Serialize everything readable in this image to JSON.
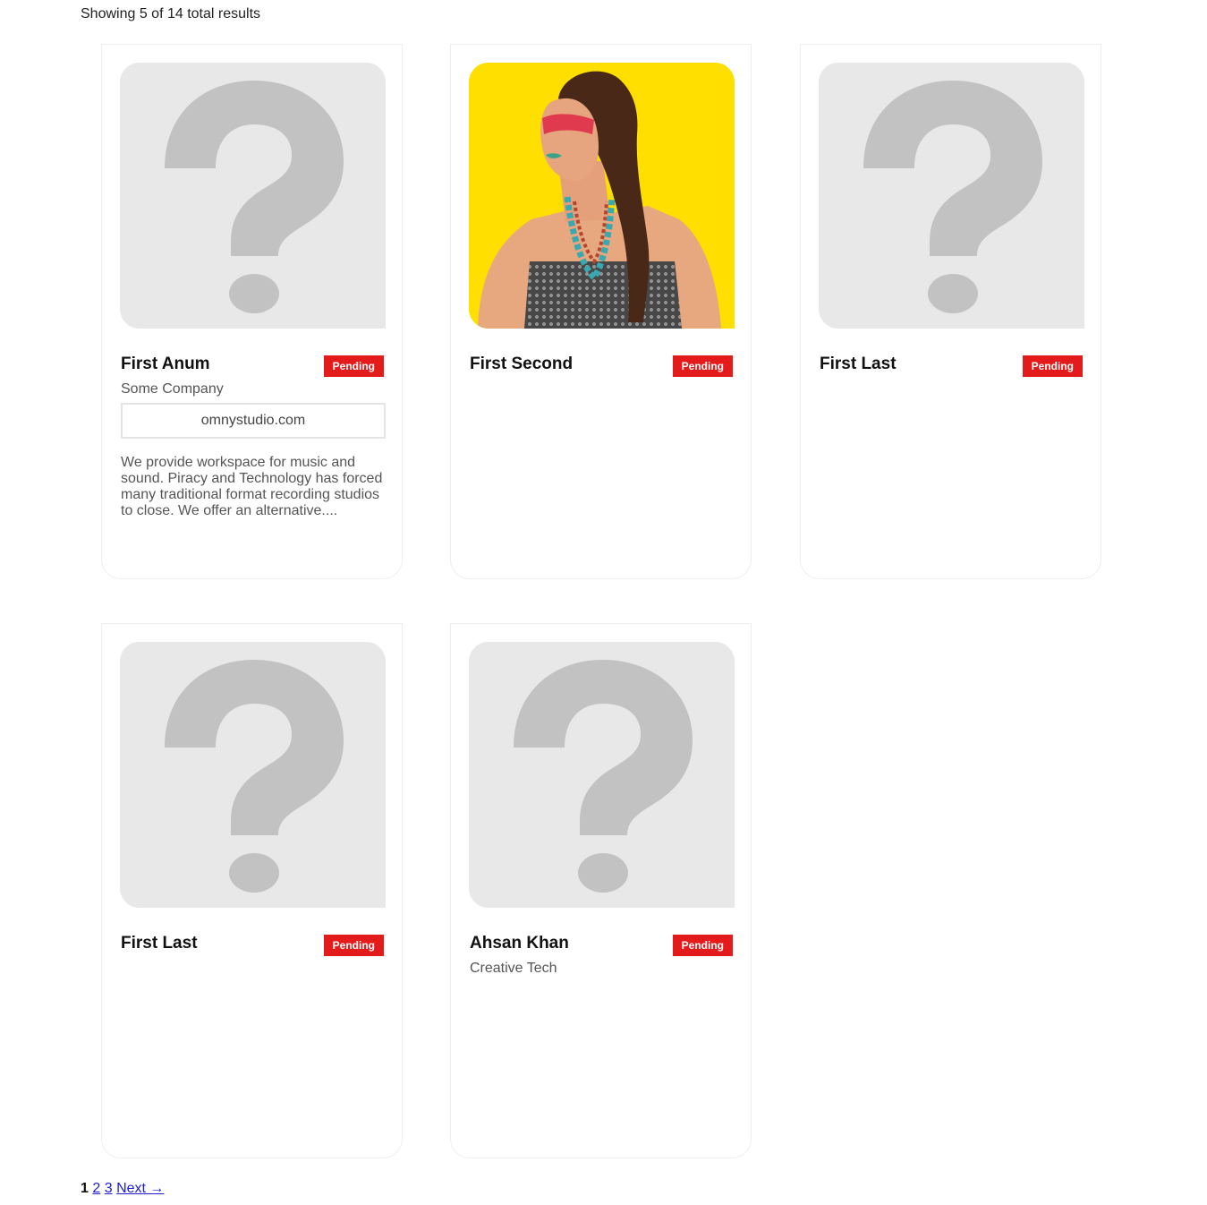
{
  "results_count": "Showing 5 of 14 total results",
  "colors": {
    "badge": "#e41b1b",
    "placeholder_bg": "#e8e8e8",
    "placeholder_mark": "#c2c2c2",
    "photo_bg": "#ffdf00",
    "link": "#1d1dcc"
  },
  "cards": [
    {
      "name": "First Anum",
      "status": "Pending",
      "image": "question-mark-placeholder",
      "company": "Some Company",
      "website": "omnystudio.com",
      "description": "We provide workspace for music and sound. Piracy and Technology has forced many traditional format recording studios to close. We offer an alternative...."
    },
    {
      "name": "First Second",
      "status": "Pending",
      "image": "profile-photo"
    },
    {
      "name": "First Last",
      "status": "Pending",
      "image": "question-mark-placeholder"
    },
    {
      "name": "First Last",
      "status": "Pending",
      "image": "question-mark-placeholder"
    },
    {
      "name": "Ahsan Khan",
      "status": "Pending",
      "image": "question-mark-placeholder",
      "company": "Creative Tech"
    }
  ],
  "pagination": {
    "current": "1",
    "pages": [
      "2",
      "3"
    ],
    "next": "Next →"
  }
}
